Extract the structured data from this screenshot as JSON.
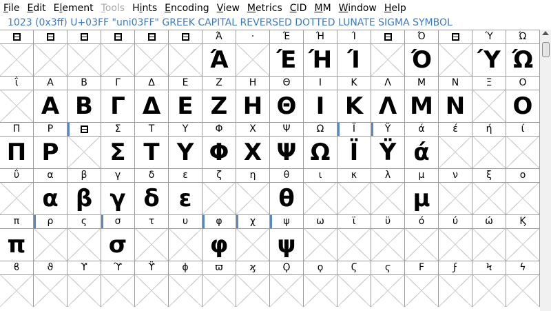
{
  "menubar": {
    "items": [
      {
        "label": "File",
        "mnemonic": "F",
        "rest": "ile",
        "disabled": false,
        "name": "menu-file"
      },
      {
        "label": "Edit",
        "mnemonic": "E",
        "rest": "dit",
        "disabled": false,
        "name": "menu-edit"
      },
      {
        "label": "Element",
        "mnemonic": "l",
        "pre": "E",
        "rest": "ement",
        "disabled": false,
        "name": "menu-element"
      },
      {
        "label": "Tools",
        "mnemonic": "T",
        "rest": "ools",
        "disabled": true,
        "name": "menu-tools"
      },
      {
        "label": "Hints",
        "mnemonic": "i",
        "pre": "H",
        "rest": "nts",
        "disabled": false,
        "name": "menu-hints"
      },
      {
        "label": "Encoding",
        "mnemonic": "E",
        "rest": "ncoding",
        "disabled": false,
        "name": "menu-encoding"
      },
      {
        "label": "View",
        "mnemonic": "V",
        "rest": "iew",
        "disabled": false,
        "name": "menu-view"
      },
      {
        "label": "Metrics",
        "mnemonic": "M",
        "rest": "etrics",
        "disabled": false,
        "name": "menu-metrics"
      },
      {
        "label": "CID",
        "mnemonic": "C",
        "rest": "ID",
        "disabled": false,
        "name": "menu-cid"
      },
      {
        "label": "MM",
        "mnemonic": "M",
        "rest": "M",
        "disabled": false,
        "name": "menu-mm"
      },
      {
        "label": "Window",
        "mnemonic": "W",
        "rest": "indow",
        "disabled": false,
        "name": "menu-window"
      },
      {
        "label": "Help",
        "mnemonic": "H",
        "rest": "elp",
        "disabled": false,
        "name": "menu-help"
      }
    ]
  },
  "info": {
    "text": "1023 (0x3ff) U+03FF \"uni03FF\" GREEK CAPITAL REVERSED DOTTED LUNATE SIGMA SYMBOL"
  },
  "colors": {
    "info_text": "#3d79c6",
    "selected_marker": "#5b87c2",
    "grid_line": "#9b9b9b"
  },
  "rows": [
    {
      "labels": [
        "■",
        "■",
        "■",
        "■",
        "■",
        "■",
        "Ά",
        "·",
        "Έ",
        "Ή",
        "Ί",
        "■",
        "Ό",
        "■",
        "Ύ",
        "Ώ"
      ],
      "glyphs": [
        "",
        "",
        "",
        "",
        "",
        "",
        "Ά",
        "",
        "Έ",
        "Ή",
        "Ί",
        "",
        "Ό",
        "",
        "Ύ",
        "Ώ"
      ],
      "sel": [
        false,
        false,
        false,
        false,
        false,
        false,
        false,
        false,
        false,
        false,
        false,
        false,
        false,
        false,
        false,
        false
      ]
    },
    {
      "labels": [
        "ΐ",
        "Α",
        "Β",
        "Γ",
        "Δ",
        "Ε",
        "Ζ",
        "Η",
        "Θ",
        "Ι",
        "Κ",
        "Λ",
        "Μ",
        "Ν",
        "Ξ",
        "Ο"
      ],
      "glyphs": [
        "",
        "Α",
        "Β",
        "Γ",
        "Δ",
        "Ε",
        "Ζ",
        "Η",
        "Θ",
        "Ι",
        "Κ",
        "Λ",
        "Μ",
        "Ν",
        "",
        "Ο"
      ],
      "sel": [
        false,
        false,
        false,
        false,
        false,
        false,
        false,
        false,
        false,
        false,
        false,
        false,
        false,
        false,
        false,
        false
      ]
    },
    {
      "labels": [
        "Π",
        "Ρ",
        "■",
        "Σ",
        "Τ",
        "Υ",
        "Φ",
        "Χ",
        "Ψ",
        "Ω",
        "Ϊ",
        "Ϋ",
        "ά",
        "έ",
        "ή",
        "ί"
      ],
      "glyphs": [
        "Π",
        "Ρ",
        "",
        "Σ",
        "Τ",
        "Υ",
        "Φ",
        "Χ",
        "Ψ",
        "Ω",
        "Ϊ",
        "Ϋ",
        "ά",
        "",
        "",
        ""
      ],
      "sel": [
        false,
        false,
        true,
        false,
        false,
        false,
        false,
        false,
        false,
        false,
        true,
        true,
        false,
        false,
        false,
        false
      ]
    },
    {
      "labels": [
        "ΰ",
        "α",
        "β",
        "γ",
        "δ",
        "ε",
        "ζ",
        "η",
        "θ",
        "ι",
        "κ",
        "λ",
        "μ",
        "ν",
        "ξ",
        "ο"
      ],
      "glyphs": [
        "",
        "α",
        "β",
        "γ",
        "δ",
        "ε",
        "",
        "",
        "θ",
        "",
        "",
        "",
        "μ",
        "",
        "",
        ""
      ],
      "sel": [
        false,
        false,
        false,
        false,
        false,
        false,
        false,
        false,
        false,
        false,
        false,
        false,
        false,
        false,
        false,
        false
      ]
    },
    {
      "labels": [
        "π",
        "ρ",
        "ς",
        "σ",
        "τ",
        "υ",
        "φ",
        "χ",
        "ψ",
        "ω",
        "ϊ",
        "ϋ",
        "ό",
        "ύ",
        "ώ",
        "Ϗ"
      ],
      "glyphs": [
        "π",
        "",
        "",
        "σ",
        "",
        "",
        "φ",
        "",
        "ψ",
        "",
        "",
        "",
        "",
        "",
        "",
        ""
      ],
      "sel": [
        false,
        true,
        false,
        true,
        false,
        false,
        true,
        true,
        true,
        false,
        false,
        false,
        false,
        false,
        false,
        false
      ]
    },
    {
      "labels": [
        "ϐ",
        "ϑ",
        "ϒ",
        "ϓ",
        "ϔ",
        "ϕ",
        "ϖ",
        "ϗ",
        "Ϙ",
        "ϙ",
        "Ϛ",
        "ϛ",
        "Ϝ",
        "ϝ",
        "Ϟ",
        "ϟ"
      ],
      "glyphs": [
        "",
        "",
        "",
        "",
        "",
        "",
        "",
        "",
        "",
        "",
        "",
        "",
        "",
        "",
        "",
        ""
      ],
      "sel": [
        false,
        false,
        false,
        false,
        false,
        false,
        false,
        false,
        false,
        false,
        false,
        false,
        false,
        false,
        false,
        false
      ]
    }
  ]
}
